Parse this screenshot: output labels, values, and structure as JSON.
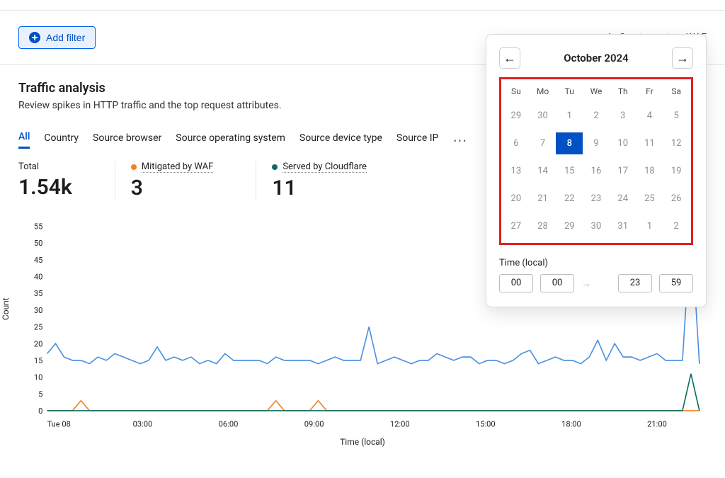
{
  "toolbar": {
    "add_filter": "Add filter",
    "create_waf": "Create custom WAF"
  },
  "section": {
    "title": "Traffic analysis",
    "subtitle": "Review spikes in HTTP traffic and the top request attributes."
  },
  "tabs": [
    "All",
    "Country",
    "Source browser",
    "Source operating system",
    "Source device type",
    "Source IP"
  ],
  "metrics": {
    "total_label": "Total",
    "total_value": "1.54k",
    "mitigated_label": "Mitigated by WAF",
    "mitigated_value": "3",
    "served_label": "Served by Cloudflare",
    "served_value": "11"
  },
  "datepicker": {
    "month": "October 2024",
    "dow": [
      "Su",
      "Mo",
      "Tu",
      "We",
      "Th",
      "Fr",
      "Sa"
    ],
    "cells": [
      "29",
      "30",
      "1",
      "2",
      "3",
      "4",
      "5",
      "6",
      "7",
      "8",
      "9",
      "10",
      "11",
      "12",
      "13",
      "14",
      "15",
      "16",
      "17",
      "18",
      "19",
      "20",
      "21",
      "22",
      "23",
      "24",
      "25",
      "26",
      "27",
      "28",
      "29",
      "30",
      "31",
      "1",
      "2"
    ],
    "selected_index": 9,
    "time_label": "Time (local)",
    "t_from_h": "00",
    "t_from_m": "00",
    "t_to_h": "23",
    "t_to_m": "59"
  },
  "chart_data": {
    "type": "line",
    "ylabel": "Count",
    "xlabel": "Time (local)",
    "ylim": [
      0,
      55
    ],
    "yticks": [
      0,
      5,
      10,
      15,
      20,
      25,
      30,
      35,
      40,
      45,
      50,
      55
    ],
    "x_labels": [
      "Tue 08",
      "03:00",
      "06:00",
      "09:00",
      "12:00",
      "15:00",
      "18:00",
      "21:00"
    ],
    "series": [
      {
        "name": "Total",
        "color": "#4a90e2",
        "values": [
          17,
          20,
          16,
          15,
          15,
          14,
          16,
          15,
          17,
          16,
          15,
          14,
          15,
          19,
          15,
          16,
          15,
          16,
          14,
          15,
          14,
          17,
          15,
          15,
          15,
          15,
          14,
          16,
          15,
          15,
          15,
          15,
          14,
          15,
          16,
          15,
          15,
          15,
          25,
          14,
          15,
          16,
          15,
          14,
          15,
          15,
          17,
          16,
          15,
          16,
          16,
          14,
          15,
          15,
          14,
          15,
          17,
          18,
          14,
          15,
          16,
          15,
          15,
          14,
          16,
          21,
          15,
          20,
          16,
          16,
          15,
          16,
          17,
          15,
          15,
          15,
          55,
          14
        ]
      },
      {
        "name": "Mitigated by WAF",
        "color": "#f48120",
        "values": [
          0,
          0,
          0,
          0,
          3,
          0,
          0,
          0,
          0,
          0,
          0,
          0,
          0,
          0,
          0,
          0,
          0,
          0,
          0,
          0,
          0,
          0,
          0,
          0,
          0,
          0,
          0,
          3,
          0,
          0,
          0,
          0,
          3,
          0,
          0,
          0,
          0,
          0,
          0,
          0,
          0,
          0,
          0,
          0,
          0,
          0,
          0,
          0,
          0,
          0,
          0,
          0,
          0,
          0,
          0,
          0,
          0,
          0,
          0,
          0,
          0,
          0,
          0,
          0,
          0,
          0,
          0,
          0,
          0,
          0,
          0,
          0,
          0,
          0,
          0,
          0,
          0,
          0
        ]
      },
      {
        "name": "Served by Cloudflare",
        "color": "#0d6b63",
        "values": [
          0,
          0,
          0,
          0,
          0,
          0,
          0,
          0,
          0,
          0,
          0,
          0,
          0,
          0,
          0,
          0,
          0,
          0,
          0,
          0,
          0,
          0,
          0,
          0,
          0,
          0,
          0,
          0,
          0,
          0,
          0,
          0,
          0,
          0,
          0,
          0,
          0,
          0,
          0,
          0,
          0,
          0,
          0,
          0,
          0,
          0,
          0,
          0,
          0,
          0,
          0,
          0,
          0,
          0,
          0,
          0,
          0,
          0,
          0,
          0,
          0,
          0,
          0,
          0,
          0,
          0,
          0,
          0,
          0,
          0,
          0,
          0,
          0,
          0,
          0,
          0,
          11,
          0
        ]
      }
    ]
  }
}
